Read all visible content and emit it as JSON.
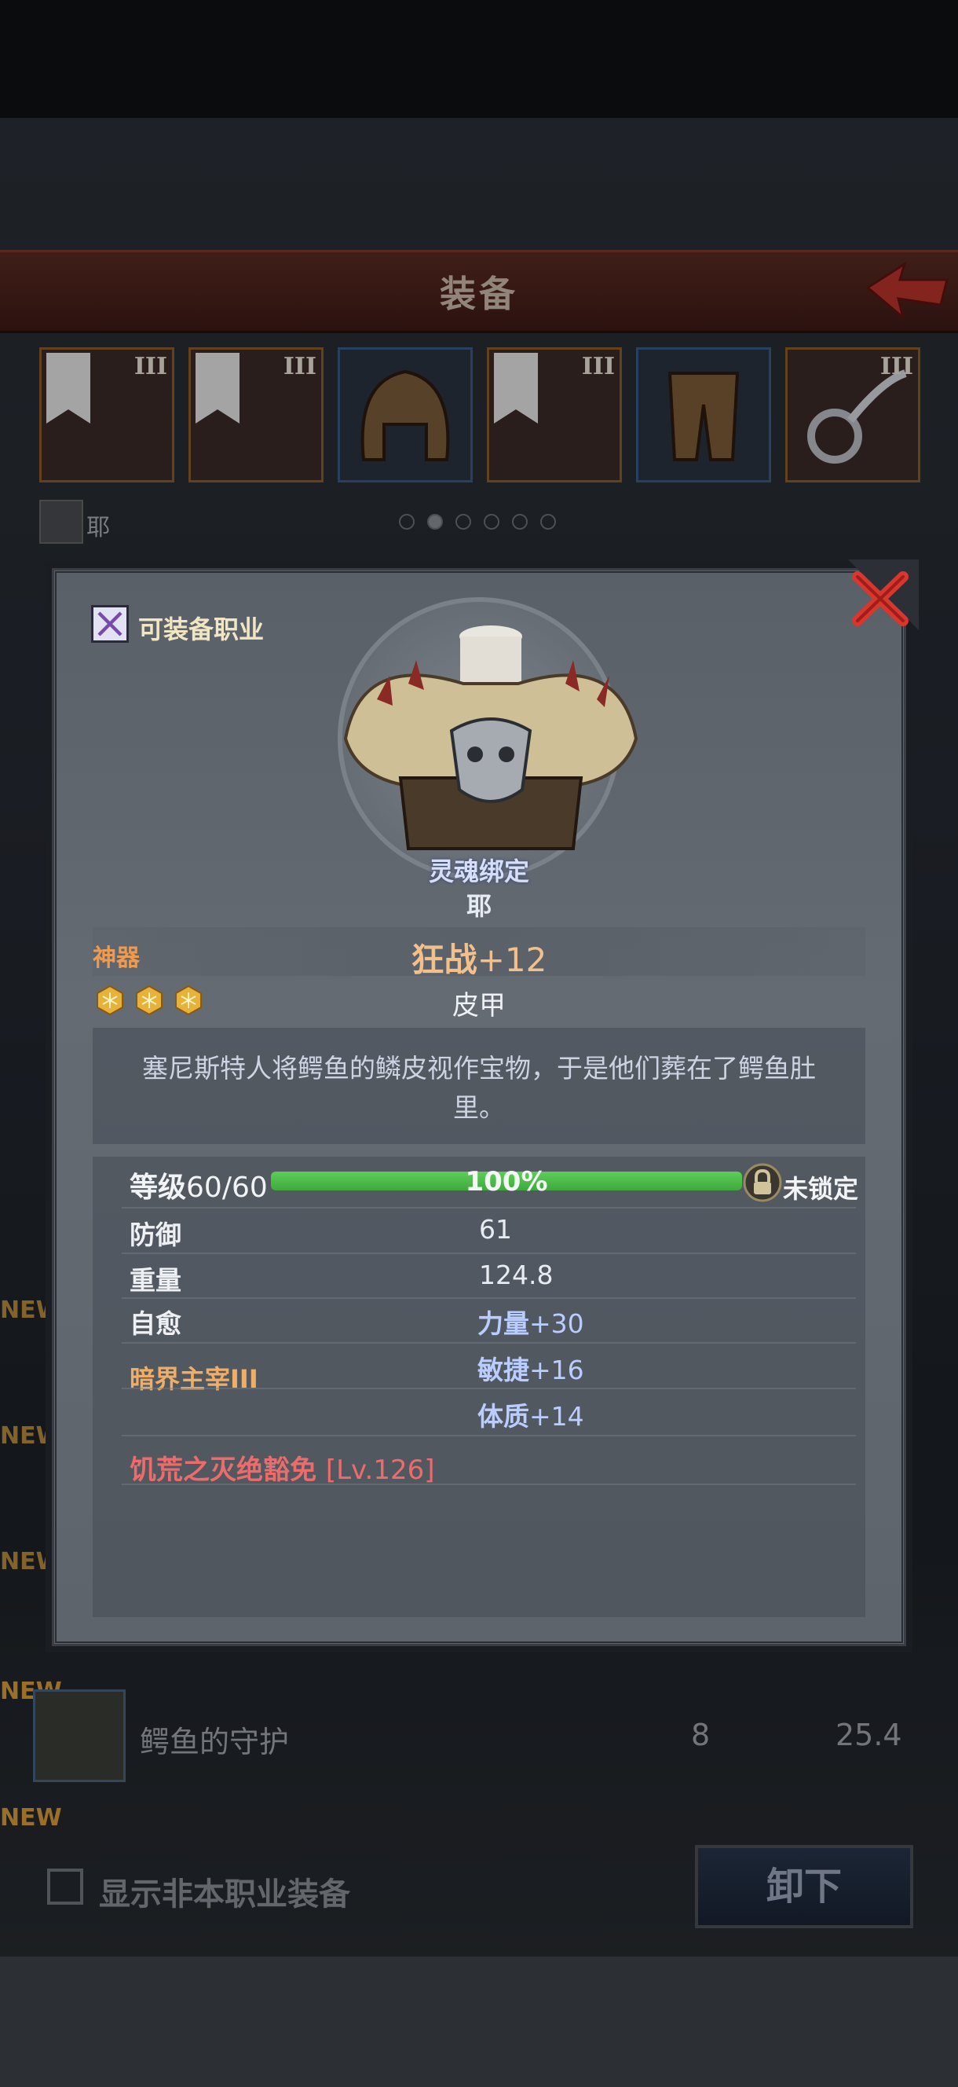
{
  "header": {
    "title": "装备"
  },
  "equip_slots": [
    {
      "tier": "III",
      "rarity": "orange"
    },
    {
      "tier": "III",
      "rarity": "orange"
    },
    {
      "tier": "",
      "rarity": "blue"
    },
    {
      "tier": "III",
      "rarity": "orange"
    },
    {
      "tier": "",
      "rarity": "blue"
    },
    {
      "tier": "III",
      "rarity": "orange"
    }
  ],
  "character": {
    "name": "耶"
  },
  "pager": {
    "count": 6,
    "active": 1
  },
  "background_list": {
    "new_badge": "NEW",
    "row": {
      "name": "鳄鱼的守护",
      "value1": "8",
      "value2": "25.4"
    }
  },
  "footer": {
    "show_other_class_label": "显示非本职业装备",
    "unequip_label": "卸下"
  },
  "item": {
    "class_label": "可装备职业",
    "soulbound": "灵魂绑定",
    "owner": "耶",
    "rarity": "神器",
    "name": "狂战",
    "plus": "+12",
    "type": "皮甲",
    "stars": 3,
    "description": "塞尼斯特人将鳄鱼的鳞皮视作宝物，于是他们葬在了鳄鱼肚里。",
    "level": {
      "label": "等级",
      "value": "60/60",
      "percent_text": "100%",
      "progress": 1.0
    },
    "lock_label": "未锁定",
    "stats": [
      {
        "label": "防御",
        "value": "61"
      },
      {
        "label": "重量",
        "value": "124.8"
      },
      {
        "label": "自愈",
        "value": ""
      }
    ],
    "set_name": "暗界主宰III",
    "bonuses": [
      {
        "name": "力量",
        "value": "+30"
      },
      {
        "name": "敏捷",
        "value": "+16"
      },
      {
        "name": "体质",
        "value": "+14"
      }
    ],
    "legend_skill": {
      "name": "饥荒之灭绝豁免",
      "level": "[Lv.126]"
    }
  },
  "colors": {
    "accent_orange": "#f2c08a",
    "rarity_orange": "#ec9b52",
    "bonus_blue": "#b9cdff",
    "legend_red": "#ec6c6c",
    "progress_green": "#4fbf4c"
  }
}
